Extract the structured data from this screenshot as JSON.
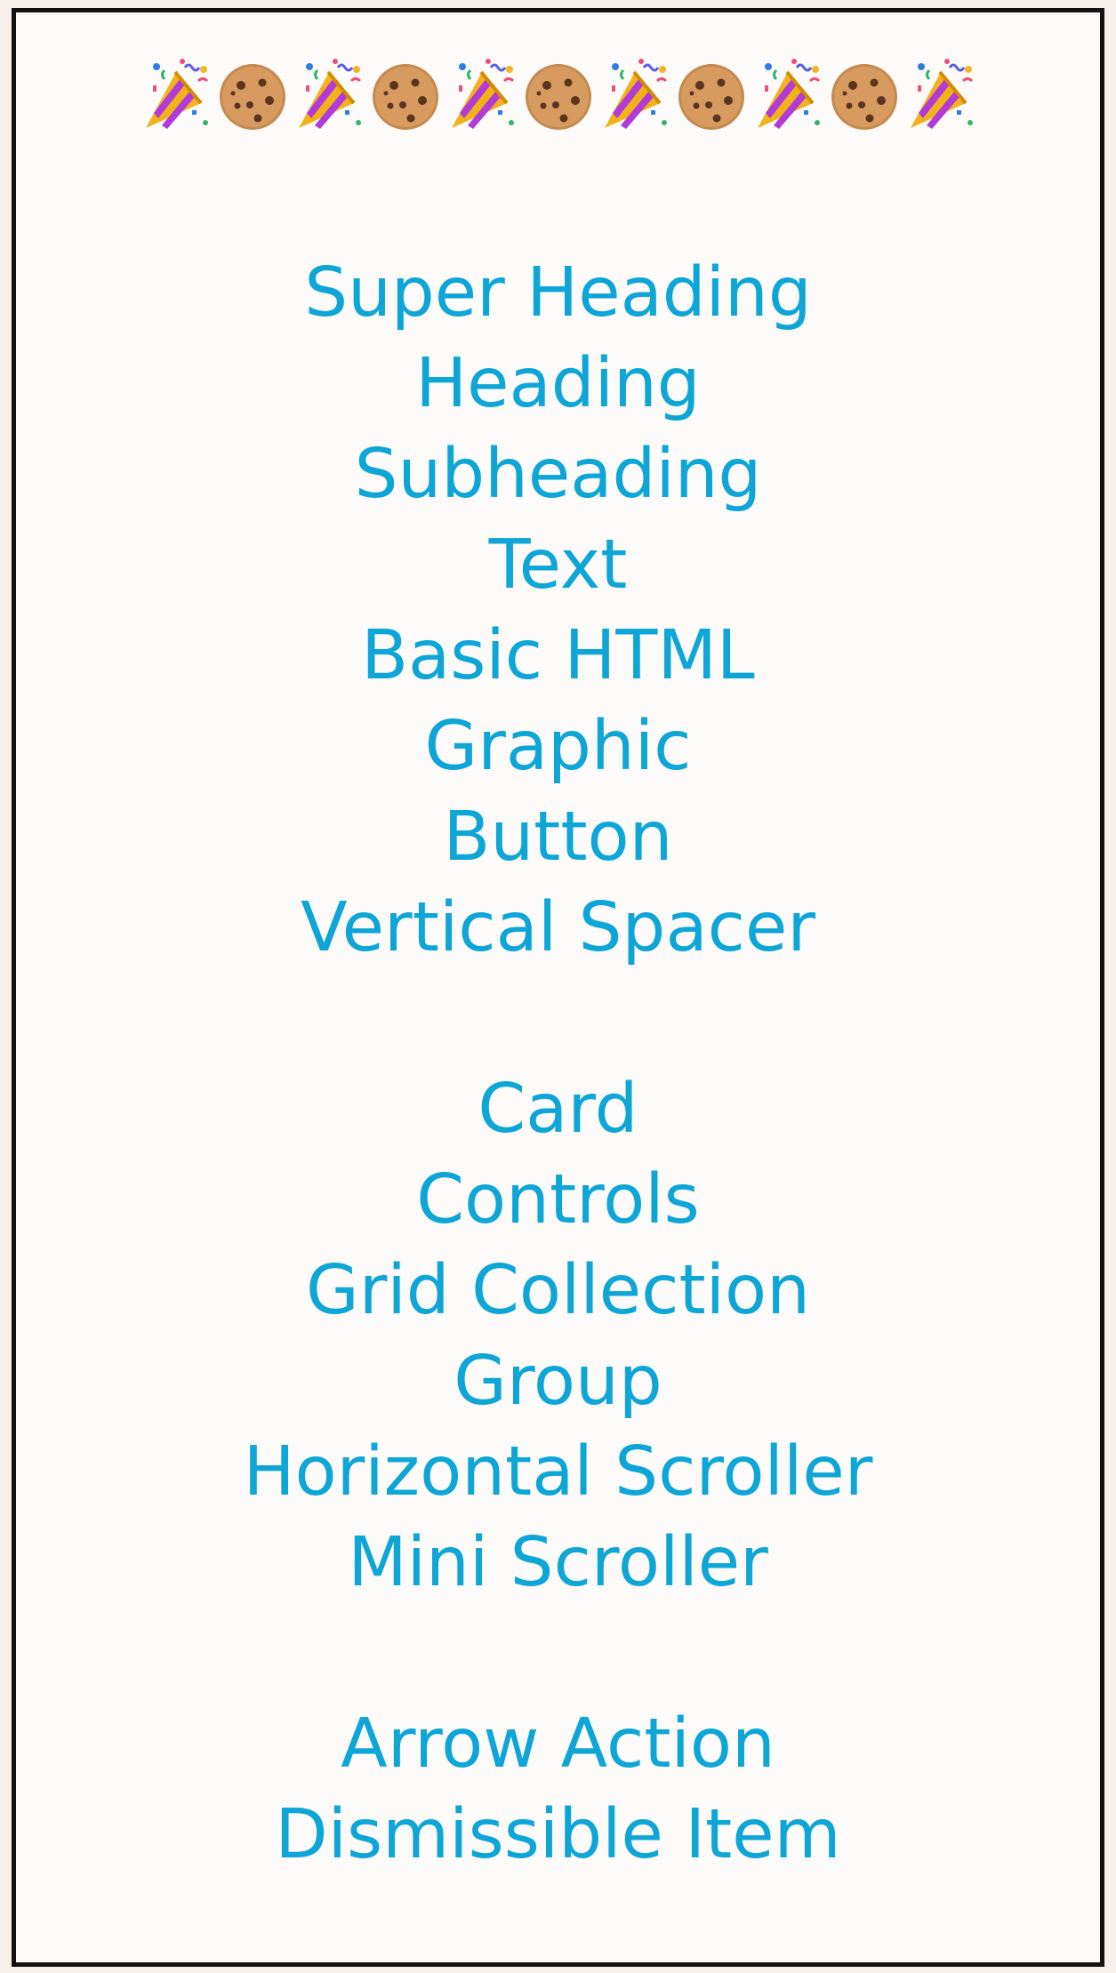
{
  "header": {
    "emoji_sequence": [
      {
        "icon": "party-popper-icon"
      },
      {
        "icon": "cookie-icon"
      },
      {
        "icon": "party-popper-icon"
      },
      {
        "icon": "cookie-icon"
      },
      {
        "icon": "party-popper-icon"
      },
      {
        "icon": "cookie-icon"
      },
      {
        "icon": "party-popper-icon"
      },
      {
        "icon": "cookie-icon"
      },
      {
        "icon": "party-popper-icon"
      },
      {
        "icon": "cookie-icon"
      },
      {
        "icon": "party-popper-icon"
      }
    ]
  },
  "menu": {
    "group1": [
      "Super Heading",
      "Heading",
      "Subheading",
      "Text",
      "Basic HTML",
      "Graphic",
      "Button",
      "Vertical Spacer"
    ],
    "group2": [
      "Card",
      "Controls",
      "Grid Collection",
      "Group",
      "Horizontal Scroller",
      "Mini Scroller"
    ],
    "group3": [
      "Arrow Action",
      "Dismissible Item"
    ]
  },
  "colors": {
    "text": "#0ea5d7",
    "page_bg": "#f7efe9",
    "frame_bg": "#fdfbfa",
    "frame_border": "#111111"
  }
}
